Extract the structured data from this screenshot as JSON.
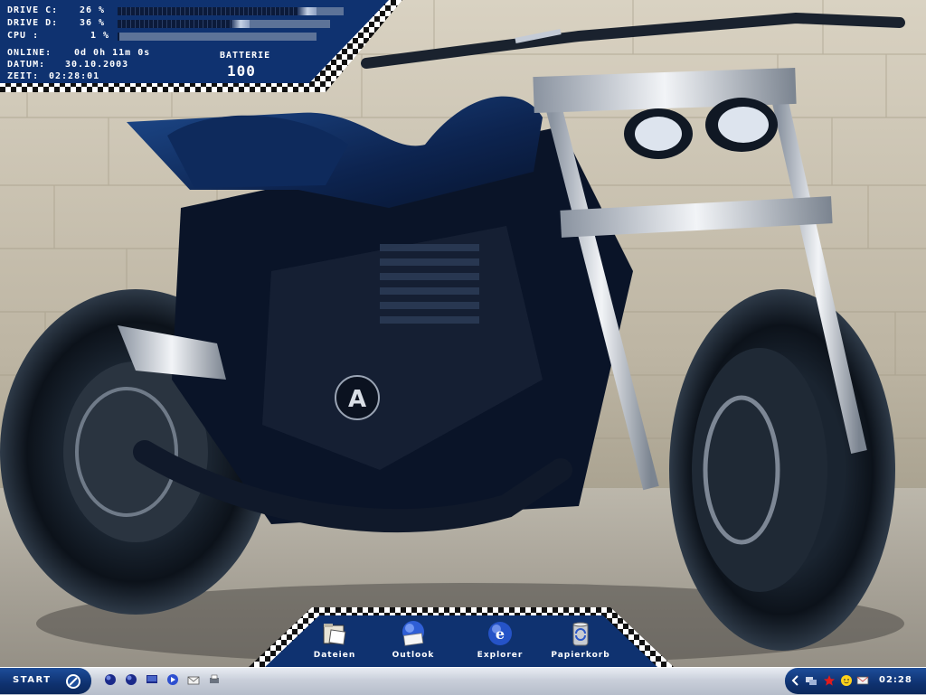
{
  "stats": {
    "drive_c_label": "DRIVE C:",
    "drive_c_value": "26 %",
    "drive_c_fill": 0.88,
    "drive_d_label": "DRIVE D:",
    "drive_d_value": "36 %",
    "drive_d_fill": 0.62,
    "cpu_label": "CPU :",
    "cpu_value": "1 %",
    "cpu_fill": 0.01,
    "online_label": "ONLINE:",
    "online_value": "0d 0h 11m 0s",
    "datum_label": "DATUM:",
    "datum_value": "30.10.2003",
    "zeit_label": "ZEIT:",
    "zeit_value": "02:28:01",
    "batterie_label": "BATTERIE",
    "batterie_value": "100"
  },
  "dock": {
    "items": [
      {
        "label": "Dateien",
        "icon": "folder-icon"
      },
      {
        "label": "Outlook",
        "icon": "outlook-icon"
      },
      {
        "label": "Explorer",
        "icon": "internet-explorer-icon"
      },
      {
        "label": "Papierkorb",
        "icon": "recycle-bin-icon"
      }
    ]
  },
  "taskbar": {
    "start_label": "START",
    "clock": "02:28",
    "quick_launch": [
      "globe-icon",
      "globe-icon",
      "desktop-icon",
      "media-icon",
      "mail-icon",
      "printer-icon"
    ],
    "tray_icons": [
      "network-icon",
      "star-icon",
      "smiley-icon",
      "mail-icon"
    ]
  },
  "colors": {
    "panel_blue": "#0f3270",
    "accent_light": "#c6d2e6"
  }
}
